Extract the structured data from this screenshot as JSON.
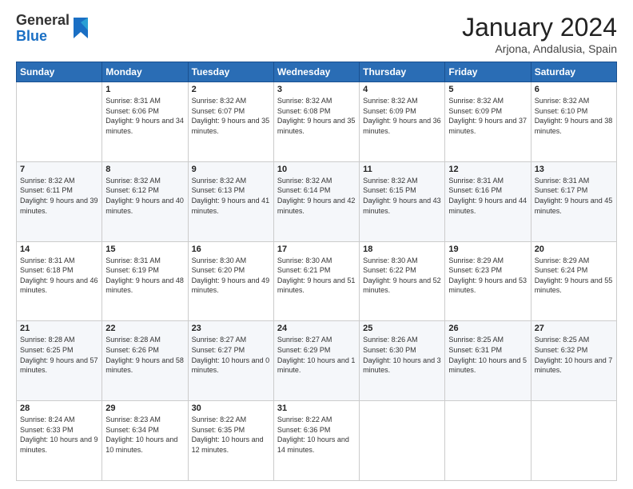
{
  "logo": {
    "general": "General",
    "blue": "Blue"
  },
  "header": {
    "month": "January 2024",
    "location": "Arjona, Andalusia, Spain"
  },
  "weekdays": [
    "Sunday",
    "Monday",
    "Tuesday",
    "Wednesday",
    "Thursday",
    "Friday",
    "Saturday"
  ],
  "weeks": [
    [
      {
        "day": "",
        "sunrise": "",
        "sunset": "",
        "daylight": ""
      },
      {
        "day": "1",
        "sunrise": "Sunrise: 8:31 AM",
        "sunset": "Sunset: 6:06 PM",
        "daylight": "Daylight: 9 hours and 34 minutes."
      },
      {
        "day": "2",
        "sunrise": "Sunrise: 8:32 AM",
        "sunset": "Sunset: 6:07 PM",
        "daylight": "Daylight: 9 hours and 35 minutes."
      },
      {
        "day": "3",
        "sunrise": "Sunrise: 8:32 AM",
        "sunset": "Sunset: 6:08 PM",
        "daylight": "Daylight: 9 hours and 35 minutes."
      },
      {
        "day": "4",
        "sunrise": "Sunrise: 8:32 AM",
        "sunset": "Sunset: 6:09 PM",
        "daylight": "Daylight: 9 hours and 36 minutes."
      },
      {
        "day": "5",
        "sunrise": "Sunrise: 8:32 AM",
        "sunset": "Sunset: 6:09 PM",
        "daylight": "Daylight: 9 hours and 37 minutes."
      },
      {
        "day": "6",
        "sunrise": "Sunrise: 8:32 AM",
        "sunset": "Sunset: 6:10 PM",
        "daylight": "Daylight: 9 hours and 38 minutes."
      }
    ],
    [
      {
        "day": "7",
        "sunrise": "Sunrise: 8:32 AM",
        "sunset": "Sunset: 6:11 PM",
        "daylight": "Daylight: 9 hours and 39 minutes."
      },
      {
        "day": "8",
        "sunrise": "Sunrise: 8:32 AM",
        "sunset": "Sunset: 6:12 PM",
        "daylight": "Daylight: 9 hours and 40 minutes."
      },
      {
        "day": "9",
        "sunrise": "Sunrise: 8:32 AM",
        "sunset": "Sunset: 6:13 PM",
        "daylight": "Daylight: 9 hours and 41 minutes."
      },
      {
        "day": "10",
        "sunrise": "Sunrise: 8:32 AM",
        "sunset": "Sunset: 6:14 PM",
        "daylight": "Daylight: 9 hours and 42 minutes."
      },
      {
        "day": "11",
        "sunrise": "Sunrise: 8:32 AM",
        "sunset": "Sunset: 6:15 PM",
        "daylight": "Daylight: 9 hours and 43 minutes."
      },
      {
        "day": "12",
        "sunrise": "Sunrise: 8:31 AM",
        "sunset": "Sunset: 6:16 PM",
        "daylight": "Daylight: 9 hours and 44 minutes."
      },
      {
        "day": "13",
        "sunrise": "Sunrise: 8:31 AM",
        "sunset": "Sunset: 6:17 PM",
        "daylight": "Daylight: 9 hours and 45 minutes."
      }
    ],
    [
      {
        "day": "14",
        "sunrise": "Sunrise: 8:31 AM",
        "sunset": "Sunset: 6:18 PM",
        "daylight": "Daylight: 9 hours and 46 minutes."
      },
      {
        "day": "15",
        "sunrise": "Sunrise: 8:31 AM",
        "sunset": "Sunset: 6:19 PM",
        "daylight": "Daylight: 9 hours and 48 minutes."
      },
      {
        "day": "16",
        "sunrise": "Sunrise: 8:30 AM",
        "sunset": "Sunset: 6:20 PM",
        "daylight": "Daylight: 9 hours and 49 minutes."
      },
      {
        "day": "17",
        "sunrise": "Sunrise: 8:30 AM",
        "sunset": "Sunset: 6:21 PM",
        "daylight": "Daylight: 9 hours and 51 minutes."
      },
      {
        "day": "18",
        "sunrise": "Sunrise: 8:30 AM",
        "sunset": "Sunset: 6:22 PM",
        "daylight": "Daylight: 9 hours and 52 minutes."
      },
      {
        "day": "19",
        "sunrise": "Sunrise: 8:29 AM",
        "sunset": "Sunset: 6:23 PM",
        "daylight": "Daylight: 9 hours and 53 minutes."
      },
      {
        "day": "20",
        "sunrise": "Sunrise: 8:29 AM",
        "sunset": "Sunset: 6:24 PM",
        "daylight": "Daylight: 9 hours and 55 minutes."
      }
    ],
    [
      {
        "day": "21",
        "sunrise": "Sunrise: 8:28 AM",
        "sunset": "Sunset: 6:25 PM",
        "daylight": "Daylight: 9 hours and 57 minutes."
      },
      {
        "day": "22",
        "sunrise": "Sunrise: 8:28 AM",
        "sunset": "Sunset: 6:26 PM",
        "daylight": "Daylight: 9 hours and 58 minutes."
      },
      {
        "day": "23",
        "sunrise": "Sunrise: 8:27 AM",
        "sunset": "Sunset: 6:27 PM",
        "daylight": "Daylight: 10 hours and 0 minutes."
      },
      {
        "day": "24",
        "sunrise": "Sunrise: 8:27 AM",
        "sunset": "Sunset: 6:29 PM",
        "daylight": "Daylight: 10 hours and 1 minute."
      },
      {
        "day": "25",
        "sunrise": "Sunrise: 8:26 AM",
        "sunset": "Sunset: 6:30 PM",
        "daylight": "Daylight: 10 hours and 3 minutes."
      },
      {
        "day": "26",
        "sunrise": "Sunrise: 8:25 AM",
        "sunset": "Sunset: 6:31 PM",
        "daylight": "Daylight: 10 hours and 5 minutes."
      },
      {
        "day": "27",
        "sunrise": "Sunrise: 8:25 AM",
        "sunset": "Sunset: 6:32 PM",
        "daylight": "Daylight: 10 hours and 7 minutes."
      }
    ],
    [
      {
        "day": "28",
        "sunrise": "Sunrise: 8:24 AM",
        "sunset": "Sunset: 6:33 PM",
        "daylight": "Daylight: 10 hours and 9 minutes."
      },
      {
        "day": "29",
        "sunrise": "Sunrise: 8:23 AM",
        "sunset": "Sunset: 6:34 PM",
        "daylight": "Daylight: 10 hours and 10 minutes."
      },
      {
        "day": "30",
        "sunrise": "Sunrise: 8:22 AM",
        "sunset": "Sunset: 6:35 PM",
        "daylight": "Daylight: 10 hours and 12 minutes."
      },
      {
        "day": "31",
        "sunrise": "Sunrise: 8:22 AM",
        "sunset": "Sunset: 6:36 PM",
        "daylight": "Daylight: 10 hours and 14 minutes."
      },
      {
        "day": "",
        "sunrise": "",
        "sunset": "",
        "daylight": ""
      },
      {
        "day": "",
        "sunrise": "",
        "sunset": "",
        "daylight": ""
      },
      {
        "day": "",
        "sunrise": "",
        "sunset": "",
        "daylight": ""
      }
    ]
  ]
}
